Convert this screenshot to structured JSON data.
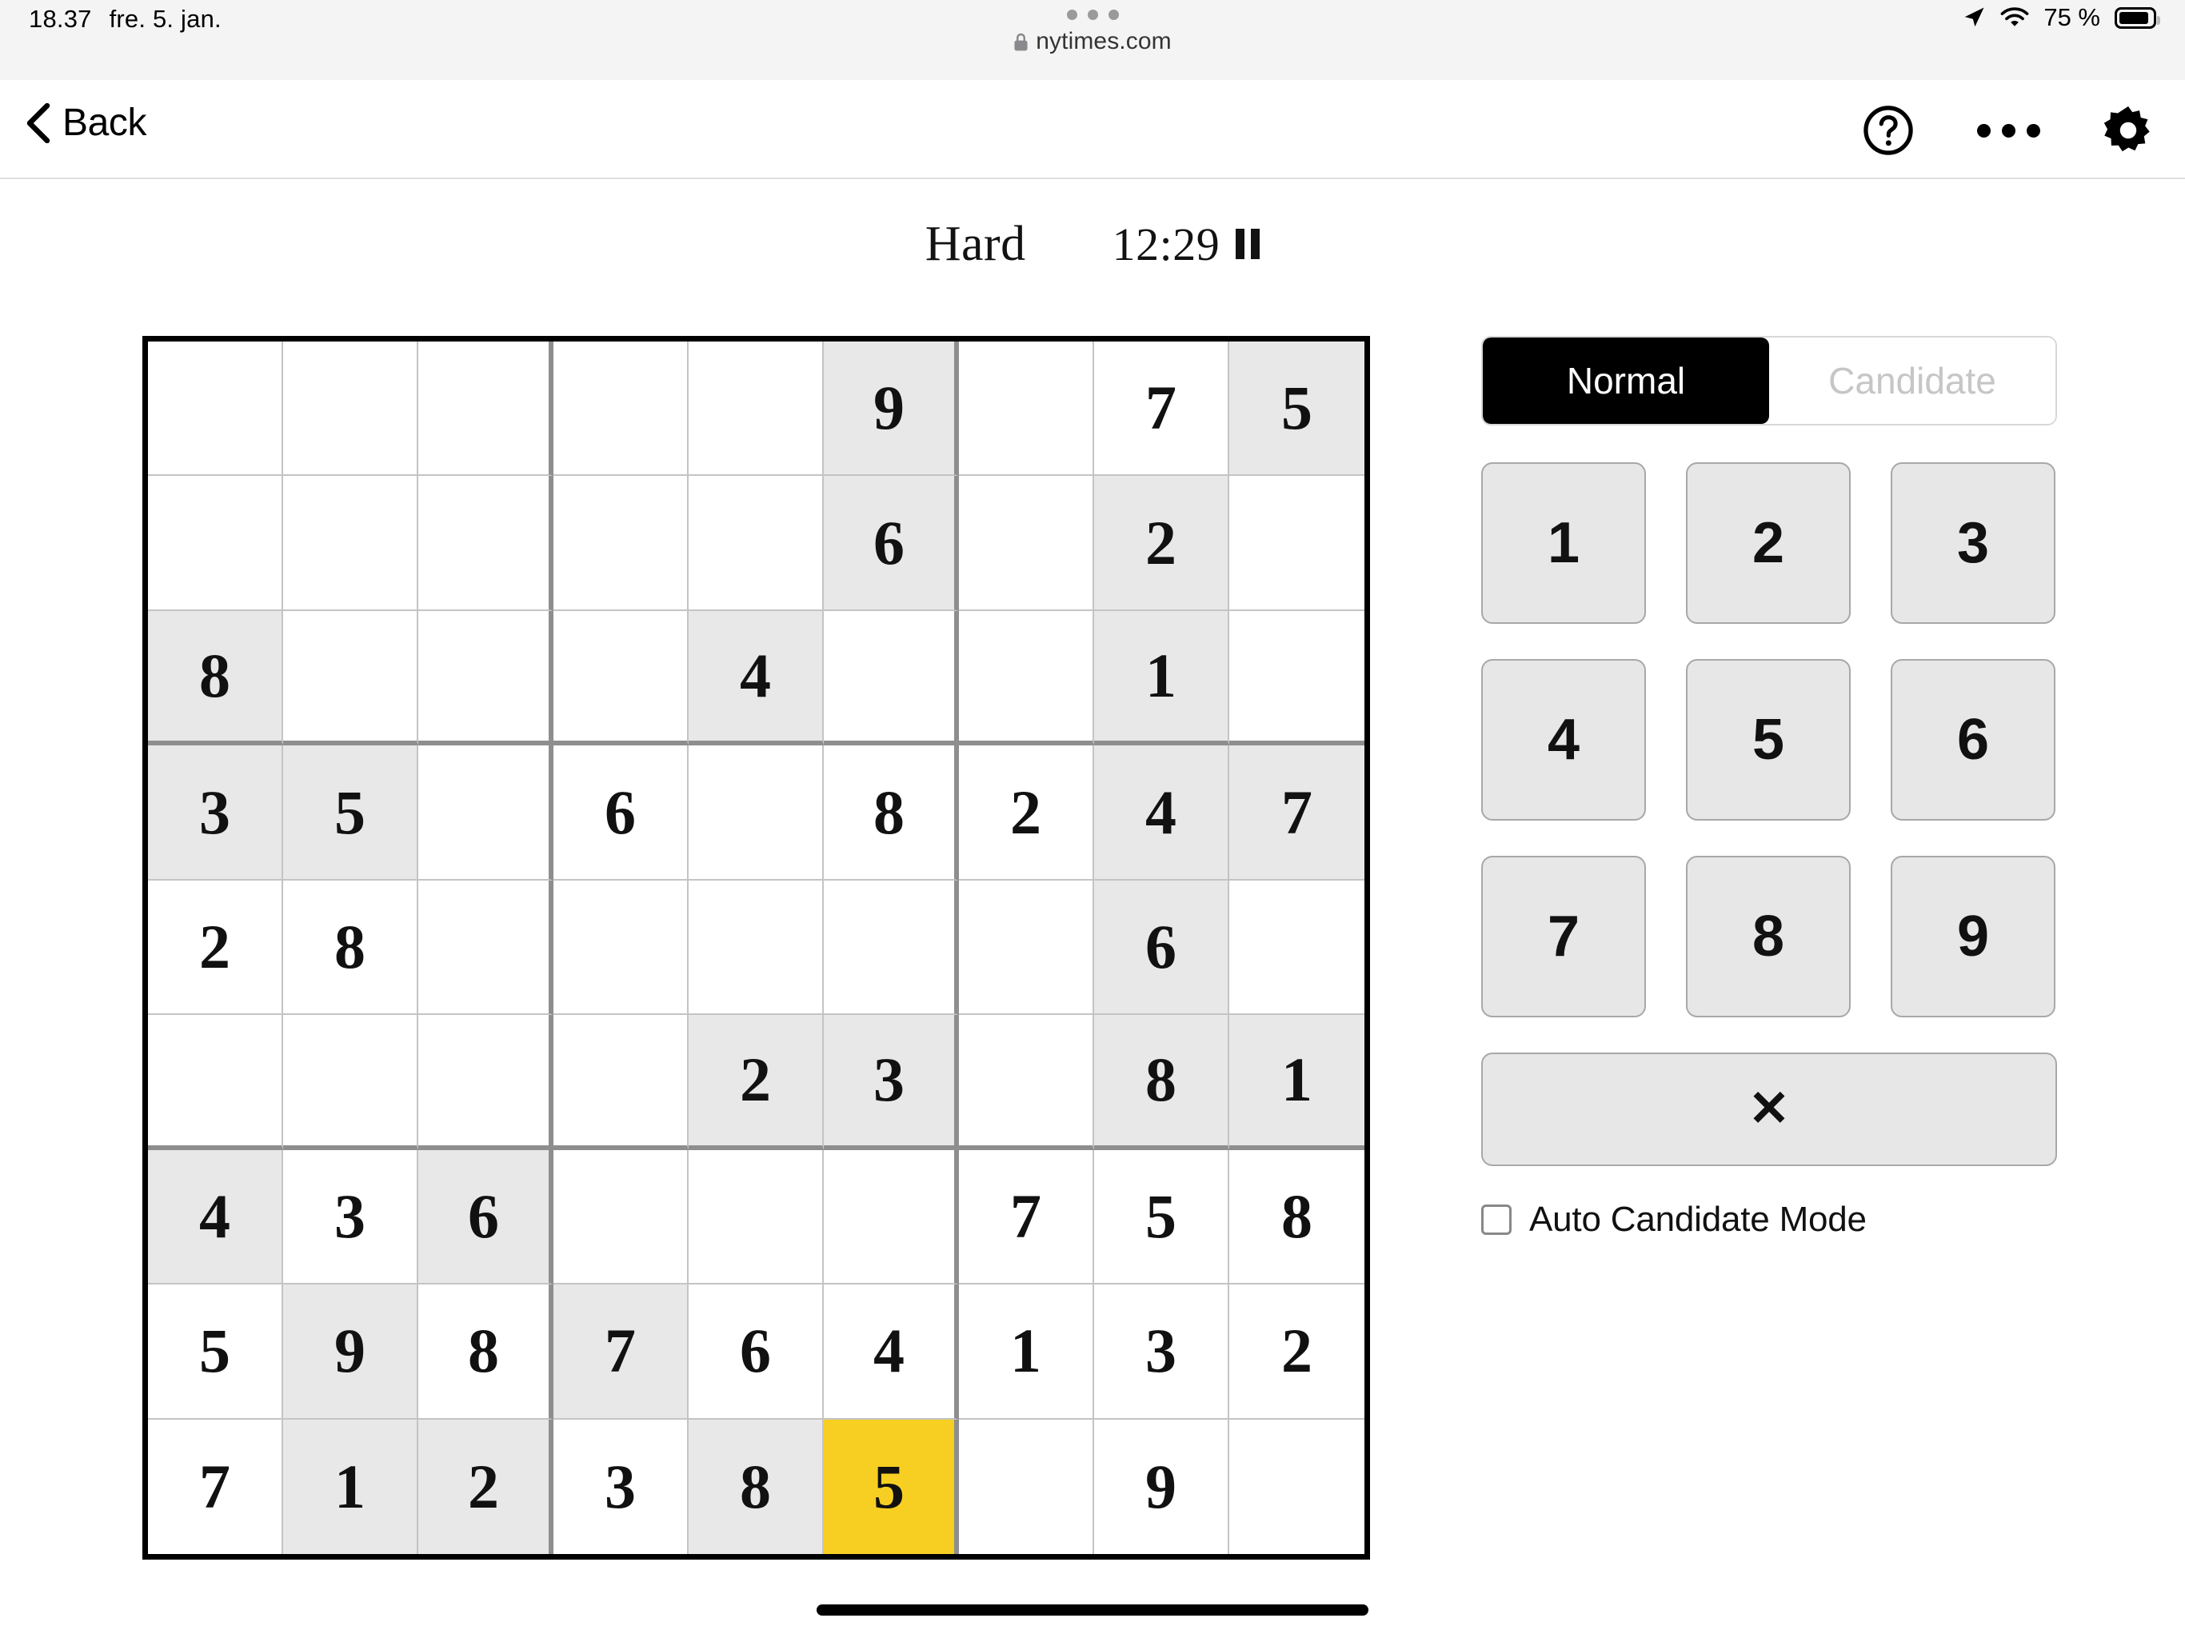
{
  "status_bar": {
    "time": "18.37",
    "date": "fre. 5. jan.",
    "battery_percent": "75 %",
    "location_icon": "location-arrow-icon",
    "wifi_icon": "wifi-icon",
    "battery_icon": "battery-icon"
  },
  "browser": {
    "url": "nytimes.com",
    "lock_icon": "lock-icon",
    "tab_dots_icon": "tab-overview-dots-icon"
  },
  "nav": {
    "back_label": "Back",
    "back_icon": "chevron-left-icon",
    "help_icon": "question-mark-circle-icon",
    "more_icon": "ellipsis-icon",
    "settings_icon": "gear-icon"
  },
  "puzzle": {
    "difficulty": "Hard",
    "timer": "12:29",
    "pause_icon": "pause-icon"
  },
  "side_panel": {
    "modes": [
      {
        "label": "Normal",
        "active": true
      },
      {
        "label": "Candidate",
        "active": false
      }
    ],
    "numbers": [
      "1",
      "2",
      "3",
      "4",
      "5",
      "6",
      "7",
      "8",
      "9"
    ],
    "delete_label": "✕",
    "delete_icon": "delete-x-icon",
    "auto_candidate_label": "Auto Candidate Mode",
    "auto_candidate_checked": false
  },
  "colors": {
    "selected_cell": "#f7cf22",
    "peer_highlight": "#e8e8e8",
    "active_mode_bg": "#000000",
    "board_border": "#000000",
    "block_border": "#8e8e8e",
    "cell_border": "#c4c4c4"
  },
  "board": {
    "rows": [
      [
        {
          "v": "",
          "s": "normal"
        },
        {
          "v": "",
          "s": "normal"
        },
        {
          "v": "",
          "s": "normal"
        },
        {
          "v": "",
          "s": "normal"
        },
        {
          "v": "",
          "s": "normal"
        },
        {
          "v": "9",
          "s": "shade"
        },
        {
          "v": "",
          "s": "normal"
        },
        {
          "v": "7",
          "s": "normal"
        },
        {
          "v": "5",
          "s": "shade"
        }
      ],
      [
        {
          "v": "",
          "s": "normal"
        },
        {
          "v": "",
          "s": "normal"
        },
        {
          "v": "",
          "s": "normal"
        },
        {
          "v": "",
          "s": "normal"
        },
        {
          "v": "",
          "s": "normal"
        },
        {
          "v": "6",
          "s": "shade"
        },
        {
          "v": "",
          "s": "normal"
        },
        {
          "v": "2",
          "s": "shade"
        },
        {
          "v": "",
          "s": "normal"
        }
      ],
      [
        {
          "v": "8",
          "s": "shade"
        },
        {
          "v": "",
          "s": "normal"
        },
        {
          "v": "",
          "s": "normal"
        },
        {
          "v": "",
          "s": "normal"
        },
        {
          "v": "4",
          "s": "shade"
        },
        {
          "v": "",
          "s": "normal"
        },
        {
          "v": "",
          "s": "normal"
        },
        {
          "v": "1",
          "s": "shade"
        },
        {
          "v": "",
          "s": "normal"
        }
      ],
      [
        {
          "v": "3",
          "s": "shade"
        },
        {
          "v": "5",
          "s": "shade"
        },
        {
          "v": "",
          "s": "normal"
        },
        {
          "v": "6",
          "s": "normal"
        },
        {
          "v": "",
          "s": "normal"
        },
        {
          "v": "8",
          "s": "normal"
        },
        {
          "v": "2",
          "s": "normal"
        },
        {
          "v": "4",
          "s": "shade"
        },
        {
          "v": "7",
          "s": "shade"
        }
      ],
      [
        {
          "v": "2",
          "s": "normal"
        },
        {
          "v": "8",
          "s": "normal"
        },
        {
          "v": "",
          "s": "normal"
        },
        {
          "v": "",
          "s": "normal"
        },
        {
          "v": "",
          "s": "normal"
        },
        {
          "v": "",
          "s": "normal"
        },
        {
          "v": "",
          "s": "normal"
        },
        {
          "v": "6",
          "s": "shade"
        },
        {
          "v": "",
          "s": "normal"
        }
      ],
      [
        {
          "v": "",
          "s": "normal"
        },
        {
          "v": "",
          "s": "normal"
        },
        {
          "v": "",
          "s": "normal"
        },
        {
          "v": "",
          "s": "normal"
        },
        {
          "v": "2",
          "s": "shade"
        },
        {
          "v": "3",
          "s": "shade"
        },
        {
          "v": "",
          "s": "normal"
        },
        {
          "v": "8",
          "s": "shade"
        },
        {
          "v": "1",
          "s": "shade"
        }
      ],
      [
        {
          "v": "4",
          "s": "shade"
        },
        {
          "v": "3",
          "s": "normal"
        },
        {
          "v": "6",
          "s": "shade"
        },
        {
          "v": "",
          "s": "normal"
        },
        {
          "v": "",
          "s": "normal"
        },
        {
          "v": "",
          "s": "normal"
        },
        {
          "v": "7",
          "s": "normal"
        },
        {
          "v": "5",
          "s": "normal"
        },
        {
          "v": "8",
          "s": "normal"
        }
      ],
      [
        {
          "v": "5",
          "s": "normal"
        },
        {
          "v": "9",
          "s": "shade"
        },
        {
          "v": "8",
          "s": "normal"
        },
        {
          "v": "7",
          "s": "shade"
        },
        {
          "v": "6",
          "s": "normal"
        },
        {
          "v": "4",
          "s": "normal"
        },
        {
          "v": "1",
          "s": "normal"
        },
        {
          "v": "3",
          "s": "normal"
        },
        {
          "v": "2",
          "s": "normal"
        }
      ],
      [
        {
          "v": "7",
          "s": "normal"
        },
        {
          "v": "1",
          "s": "shade"
        },
        {
          "v": "2",
          "s": "shade"
        },
        {
          "v": "3",
          "s": "normal"
        },
        {
          "v": "8",
          "s": "shade"
        },
        {
          "v": "5",
          "s": "sel"
        },
        {
          "v": "",
          "s": "normal"
        },
        {
          "v": "9",
          "s": "normal"
        },
        {
          "v": "",
          "s": "normal"
        }
      ]
    ]
  }
}
